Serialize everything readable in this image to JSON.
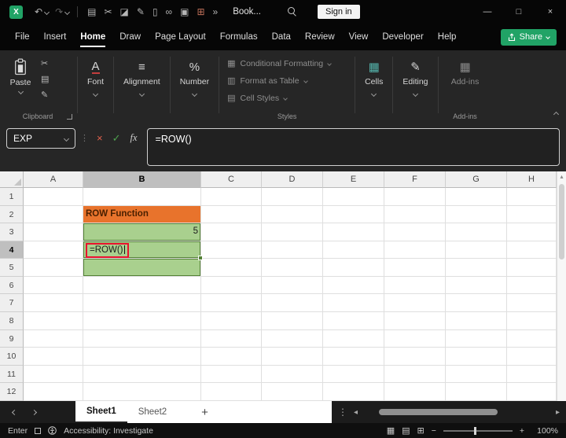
{
  "titlebar": {
    "doc_title": "Book...",
    "sign_in_label": "Sign in",
    "icons": {
      "excel_logo": "X",
      "undo": "↶",
      "redo": "↷",
      "clipboard": "▤",
      "cut": "✂",
      "image": "◪",
      "brush": "✎",
      "document": "▯",
      "link": "∞",
      "printer": "▣",
      "table": "⊞",
      "overflow": "»",
      "minimize": "—",
      "maximize": "□",
      "close": "×"
    }
  },
  "menubar": {
    "items": [
      "File",
      "Insert",
      "Home",
      "Draw",
      "Page Layout",
      "Formulas",
      "Data",
      "Review",
      "View",
      "Developer",
      "Help"
    ],
    "active": "Home",
    "share_label": "Share"
  },
  "ribbon": {
    "paste_label": "Paste",
    "clipboard_icons": {
      "cut": "✂",
      "copy": "▤",
      "format_painter": "✎"
    },
    "clipboard_group_label": "Clipboard",
    "font_label": "Font",
    "font_icon": "A",
    "alignment_label": "Alignment",
    "alignment_icon": "≡",
    "number_label": "Number",
    "number_icon": "%",
    "styles_items": [
      "Conditional Formatting",
      "Format as Table",
      "Cell Styles"
    ],
    "styles_icons": [
      "▦",
      "▥",
      "▤"
    ],
    "styles_group_label": "Styles",
    "cells_label": "Cells",
    "cells_icon": "▦",
    "editing_label": "Editing",
    "editing_icon": "✎",
    "addins_label": "Add-ins",
    "addins_icon": "▦",
    "addins_group_label": "Add-ins"
  },
  "formula_bar": {
    "name_box_value": "EXP",
    "cancel_icon": "×",
    "enter_icon": "✓",
    "fx_icon": "fx",
    "formula": "=ROW()"
  },
  "grid": {
    "columns": [
      "A",
      "B",
      "C",
      "D",
      "E",
      "F",
      "G",
      "H"
    ],
    "rows": [
      "1",
      "2",
      "3",
      "4",
      "5",
      "6",
      "7",
      "8",
      "9",
      "10",
      "11",
      "12"
    ],
    "selected_column": "B",
    "selected_row": "4",
    "cells": [
      {
        "ref": "B2",
        "text": "ROW Function",
        "style": "orange"
      },
      {
        "ref": "B3",
        "text": "5",
        "style": "green number"
      },
      {
        "ref": "B4",
        "text": "=ROW()",
        "style": "green annotated"
      },
      {
        "ref": "B5",
        "text": "",
        "style": "green"
      }
    ],
    "colors": {
      "orange_fill": "#E8732C",
      "orange_text": "#4A2000",
      "green_fill": "#A9D08E",
      "green_border": "#538135",
      "annotation_red": "#E8112D"
    },
    "scroll_up_icon": "▴"
  },
  "sheet_bar": {
    "tabs": [
      "Sheet1",
      "Sheet2"
    ],
    "active_tab": "Sheet1",
    "add_sheet_icon": "+",
    "menu_dots_icon": "⋮",
    "scroll_left_icon": "◂",
    "scroll_right_icon": "▸"
  },
  "status_bar": {
    "mode": "Enter",
    "accessibility_text": "Accessibility: Investigate",
    "view_icons": {
      "normal": "▦",
      "page_layout": "▤",
      "page_break": "⊞"
    },
    "zoom_out_icon": "−",
    "zoom_in_icon": "+",
    "zoom_level": "100%"
  },
  "colors": {
    "accent_green": "#21A366",
    "orange_fill": "#E8732C",
    "green_fill": "#A9D08E",
    "annotation_red": "#E8112D"
  }
}
